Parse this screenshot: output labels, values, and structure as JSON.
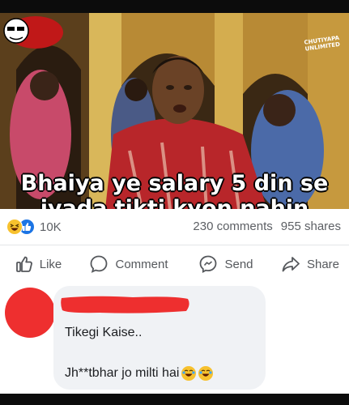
{
  "post": {
    "image": {
      "caption_line1": "Bhaiya ye salary 5 din se",
      "caption_line2": "jyada tikti kyon nahin",
      "logo_text": "CHUTIYAPA UNLIMITED"
    },
    "reactions": {
      "icons": [
        "haha-icon",
        "like-icon"
      ],
      "count": "10K"
    },
    "stats": {
      "comments": "230 comments",
      "shares": "955 shares"
    },
    "actions": [
      {
        "label": "Like",
        "icon": "thumbs-up-icon"
      },
      {
        "label": "Comment",
        "icon": "comment-bubble-icon"
      },
      {
        "label": "Send",
        "icon": "messenger-icon"
      },
      {
        "label": "Share",
        "icon": "share-arrow-icon"
      }
    ]
  },
  "comment": {
    "line1": "Tikegi Kaise..",
    "line2": "Jh**tbhar jo milti hai",
    "emojis": [
      "laughing-tears-icon",
      "laughing-tears-icon"
    ]
  },
  "colors": {
    "accent": "#1b74e4",
    "haha": "#f7c12e",
    "avatar": "#ee2f2f",
    "muted_text": "#5c5f64",
    "bubble": "#f0f2f5"
  }
}
